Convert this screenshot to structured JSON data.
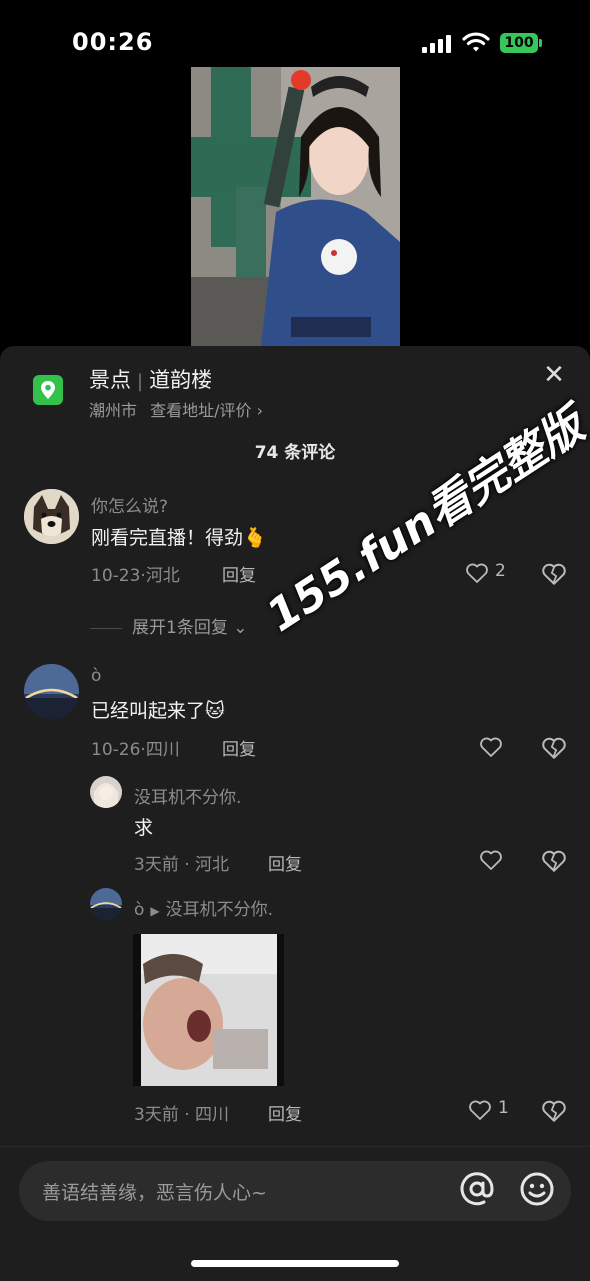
{
  "status": {
    "time": "00:26",
    "battery": "100"
  },
  "location": {
    "category": "景点",
    "name": "道韵楼",
    "city": "潮州市",
    "link": "查看地址/评价"
  },
  "comments_header": {
    "count_label": "74 条评论"
  },
  "comments": [
    {
      "user": "你怎么说?",
      "text": "刚看完直播！得劲",
      "emoji": "🫰",
      "date": "10-23",
      "region": "河北",
      "reply_label": "回复",
      "likes": "2",
      "expand_label": "展开1条回复"
    },
    {
      "user": "ò",
      "text": "已经叫起来了",
      "emoji": "🐱",
      "date": "10-26",
      "region": "四川",
      "reply_label": "回复",
      "likes": ""
    }
  ],
  "replies": [
    {
      "user": "没耳机不分你.",
      "text": "求",
      "time": "3天前",
      "region": "河北",
      "reply_label": "回复",
      "likes": ""
    },
    {
      "user": "ò",
      "reply_to": "没耳机不分你.",
      "time": "3天前",
      "region": "四川",
      "reply_label": "回复",
      "likes": "1"
    }
  ],
  "watermark": "155.fun看完整版",
  "input": {
    "placeholder": "善语结善缘，恶言伤人心~"
  },
  "colors": {
    "background": "#000000",
    "sheet": "#1e1e1e",
    "location_green": "#33c14b",
    "battery_green": "#35c759"
  }
}
